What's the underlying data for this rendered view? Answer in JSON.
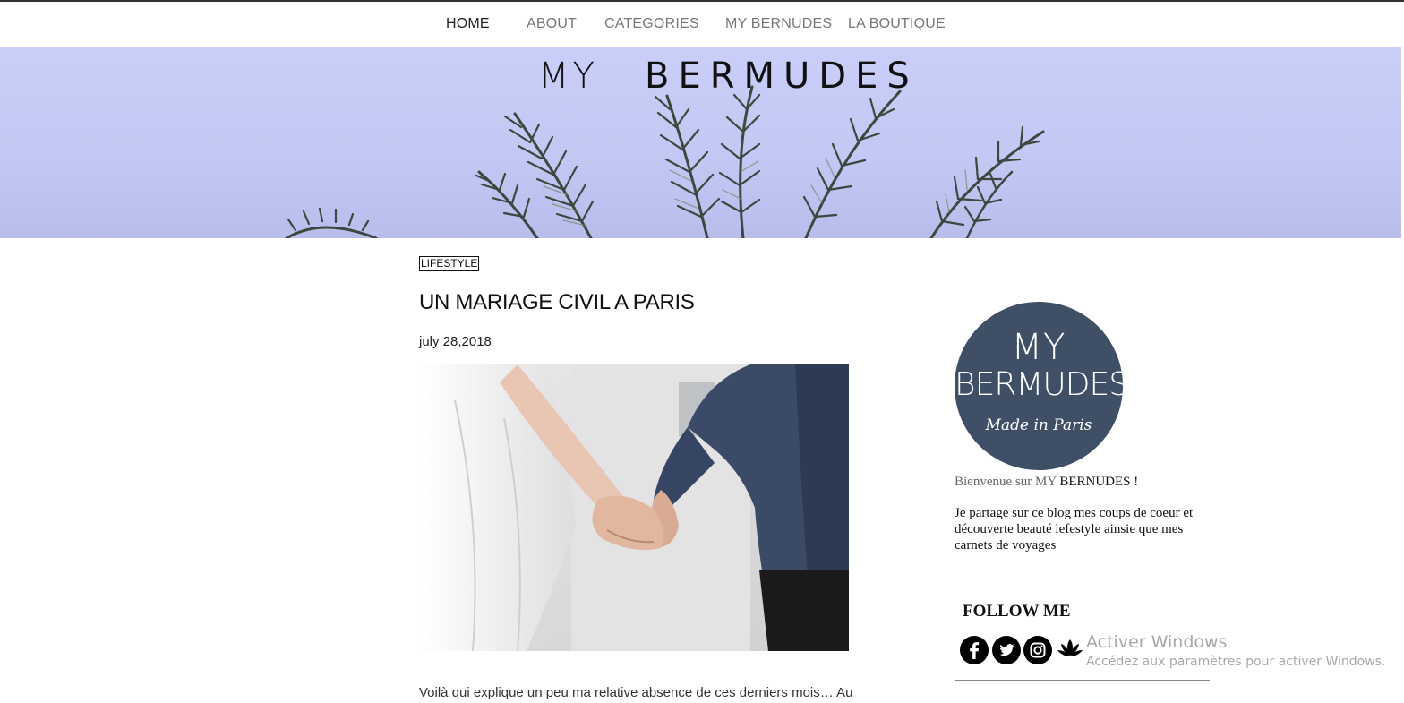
{
  "nav": {
    "items": [
      {
        "label": "HOME"
      },
      {
        "label": "ABOUT"
      },
      {
        "label": "CATEGORIES"
      },
      {
        "label": "MY BERNUDES"
      },
      {
        "label": "LA BOUTIQUE"
      }
    ],
    "active": "HOME"
  },
  "hero": {
    "title_part1": "MY",
    "title_part2": "BERMUDES"
  },
  "post": {
    "category": "LIFESTYLE",
    "title": "UN MARIAGE CIVIL A PARIS",
    "date": "july 28,2018",
    "excerpt": "Voilà qui explique un peu ma relative absence de ces derniers mois… Au"
  },
  "sidebar": {
    "logo": {
      "line1": "MY",
      "line2": "BERMUDES",
      "line3": "Made in Paris"
    },
    "welcome_prefix": "Bienvenue sur MY",
    "welcome_name": "BERNUDES !",
    "about": "Je partage sur ce blog mes coups de coeur et découverte beauté lefestyle ainsie que mes carnets de voyages",
    "follow_title": "FOLLOW ME",
    "social_icons": [
      "facebook-icon",
      "twitter-icon",
      "instagram-icon",
      "lotus-icon"
    ]
  },
  "windows_watermark": {
    "title": "Activer Windows",
    "subtitle": "Accédez aux paramètres pour activer Windows."
  },
  "colors": {
    "sky": "#c9cff8",
    "logo_bg": "#3e4f66"
  }
}
